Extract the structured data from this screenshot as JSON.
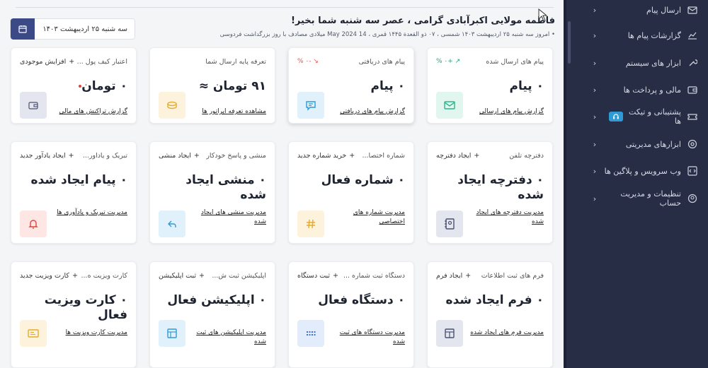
{
  "sidebar": {
    "items": [
      {
        "label": "ارسال پیام",
        "icon": "send-message-icon"
      },
      {
        "label": "گزارشات پیام ها",
        "icon": "chart-icon"
      },
      {
        "label": "ابزار های سیستم",
        "icon": "tools-icon"
      },
      {
        "label": "مالی و پرداخت ها",
        "icon": "wallet-icon"
      },
      {
        "label": "پشتیبانی و تیکت ها",
        "icon": "ticket-icon",
        "badge_icon": "headset-icon"
      },
      {
        "label": "ابزارهای مدیریتی",
        "icon": "settings-icon"
      },
      {
        "label": "وب سرویس و پلاگین ها",
        "icon": "code-icon"
      },
      {
        "label": "تنظیمات و مدیریت حساب",
        "icon": "account-icon"
      }
    ]
  },
  "header": {
    "greeting": "فاطمه مولایی اکبرآبادی گرامی ، عصر سه شنبه شما بخیر!",
    "date_line": "• امروز سه شنبه ۲۵ اردیبهشت ۱۴۰۳ شمسی ، ۰۷ ذو القعدة ۱۴۴۵ قمری ، 14 May 2024 میلادی مصادف با روز بزرگداشت فردوسی",
    "date_box": "سه شنبه ۲۵ اردیبهشت ۱۴۰۳"
  },
  "cards": [
    {
      "title": "پیام های ارسال شده",
      "pct": "+۰ %",
      "value": "۰ پیام",
      "link": "گزارش پیام های ارسالی",
      "icon": "sent-mail-icon",
      "color": "#e2f6f0",
      "fg": "#2bb58a"
    },
    {
      "title": "پیام های دریافتی",
      "pct": "-۰ %",
      "value": "۰ پیام",
      "link": "گزارش پیام های دریافتی",
      "icon": "chat-icon",
      "color": "#e0f1fb",
      "fg": "#2f9bd6"
    },
    {
      "title": "تعرفه پایه ارسال شما",
      "value": "۹۱ تومان ≈",
      "link": "مشاهده تعرفه اپراتور ها",
      "icon": "coins-icon",
      "color": "#fdf3dc",
      "fg": "#e6a92a"
    },
    {
      "title": "اعتبار کیف پول ...",
      "action": "افزایش موجودی",
      "value": "۰ تومان",
      "link": "گزارش تراکنش های مالی",
      "icon": "wallet-icon",
      "color": "#e3e6ee",
      "fg": "#4a5170"
    },
    {
      "title": "دفترچه تلفن",
      "action": "ایجاد دفترچه",
      "value": "۰ دفترچه ایجاد شده",
      "link": "مدیریت دفترچه های ایجاد شده",
      "icon": "contacts-icon",
      "color": "#e3e6ee",
      "fg": "#4a5170"
    },
    {
      "title": "شماره اختصا...",
      "action": "خرید شماره جدید",
      "value": "۰ شماره فعال",
      "link": "مدیریت شماره های اختصاصی",
      "icon": "hash-icon",
      "color": "#fdf3dc",
      "fg": "#e6a92a"
    },
    {
      "title": "منشی و پاسخ خودکار",
      "action": "ایجاد منشی",
      "value": "۰ منشی ایجاد شده",
      "link": "مدیریت منشی های ایجاد شده",
      "icon": "reply-icon",
      "color": "#e0f1fb",
      "fg": "#2f9bd6"
    },
    {
      "title": "تبریک و یادآور...",
      "action": "ایجاد یادآور جدید",
      "value": "۰ پیام ایجاد شده",
      "link": "مدیریت تبریک و یادآوری ها",
      "icon": "bell-icon",
      "color": "#fde6e4",
      "fg": "#e0433d"
    },
    {
      "title": "فرم های ثبت اطلاعات",
      "action": "ایجاد فرم",
      "value": "۰ فرم ایجاد شده",
      "link": "مدیریت فرم های ایجاد شده",
      "icon": "form-icon",
      "color": "#e3e6ee",
      "fg": "#4a5170"
    },
    {
      "title": "دستگاه ثبت شماره ...",
      "action": "ثبت دستگاه",
      "value": "۰ دستگاه فعال",
      "link": "مدیریت دستگاه های ثبت شده",
      "icon": "device-icon",
      "color": "#e3ecfb",
      "fg": "#3a6fd8"
    },
    {
      "title": "اپلیکیشن ثبت ش...",
      "action": "ثبت اپلیکیشن",
      "value": "۰ اپلیکیشن فعال",
      "link": "مدیریت اپلیکیشن های ثبت شده",
      "icon": "app-icon",
      "color": "#e0f1fb",
      "fg": "#2f9bd6"
    },
    {
      "title": "کارت ویزیت ه...",
      "action": "کارت ویزیت جدید",
      "value": "۰ کارت ویزیت فعال",
      "link": "مدیریت کارت ویزیت ها",
      "icon": "card-icon",
      "color": "#fdf3dc",
      "fg": "#e6a92a"
    }
  ]
}
